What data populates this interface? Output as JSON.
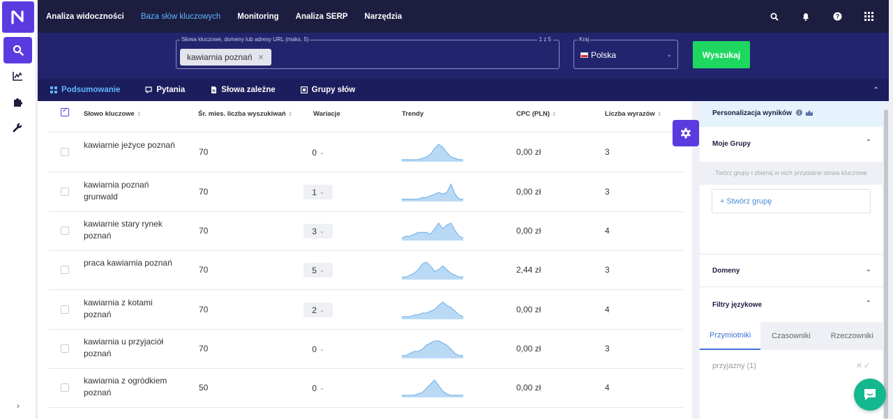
{
  "app": {
    "logo_letter": "N",
    "accent": "#5b3be0"
  },
  "topnav": [
    {
      "label": "Analiza widoczności",
      "active": false
    },
    {
      "label": "Baza słów kluczowych",
      "active": true
    },
    {
      "label": "Monitoring",
      "active": false
    },
    {
      "label": "Analiza SERP",
      "active": false
    },
    {
      "label": "Narzędzia",
      "active": false
    }
  ],
  "top_icons": [
    "search-icon",
    "bell-icon",
    "help-icon",
    "apps-grid-icon"
  ],
  "sidebar": {
    "items": [
      {
        "icon": "search-icon",
        "active": true
      },
      {
        "icon": "chart-icon",
        "active": false
      },
      {
        "icon": "puzzle-icon",
        "active": false
      },
      {
        "icon": "wrench-icon",
        "active": false
      }
    ],
    "expand_label": "›"
  },
  "search": {
    "keywords_label": "Słowa kluczowe, domeny lub adresy URL (maks. 5)",
    "counter": "1 z 5",
    "chip": "kawiarnia poznań",
    "country_label": "Kraj",
    "country_value": "Polska",
    "submit_label": "Wyszukaj"
  },
  "tabs": [
    {
      "label": "Podsumowanie",
      "icon": "grid-icon",
      "active": true
    },
    {
      "label": "Pytania",
      "icon": "question-bubble-icon",
      "active": false
    },
    {
      "label": "Słowa zależne",
      "icon": "document-icon",
      "active": false
    },
    {
      "label": "Grupy słów",
      "icon": "group-icon",
      "active": false
    }
  ],
  "table": {
    "columns": {
      "keyword": "Słowo kluczowe",
      "volume": "Śr. mies. liczba wyszukiwań",
      "variations": "Wariacje",
      "trends": "Trendy",
      "cpc": "CPC (PLN)",
      "words": "Liczba wyrazów"
    },
    "rows": [
      {
        "keyword": "kawiarnie jeżyce poznań",
        "volume": "70",
        "variations": "0",
        "cpc": "0,00 zł",
        "words": "3",
        "trend": [
          1,
          1,
          1,
          1,
          1,
          2,
          3,
          5,
          9,
          12,
          10,
          6,
          3,
          2,
          1,
          1
        ]
      },
      {
        "keyword": "kawiarnia poznań grunwald",
        "volume": "70",
        "variations": "1",
        "cpc": "0,00 zł",
        "words": "3",
        "trend": [
          1,
          1,
          1,
          1,
          1,
          2,
          2,
          3,
          4,
          5,
          4,
          5,
          10,
          4,
          1,
          1
        ]
      },
      {
        "keyword": "kawiarnie stary rynek poznań",
        "volume": "70",
        "variations": "3",
        "cpc": "0,00 zł",
        "words": "4",
        "trend": [
          1,
          2,
          2,
          3,
          4,
          4,
          4,
          3,
          6,
          9,
          6,
          8,
          9,
          5,
          2,
          1
        ]
      },
      {
        "keyword": "praca kawiarnia poznań",
        "volume": "70",
        "variations": "5",
        "cpc": "2,44 zł",
        "words": "3",
        "trend": [
          1,
          1,
          2,
          3,
          5,
          8,
          9,
          7,
          4,
          5,
          7,
          5,
          3,
          2,
          1,
          1
        ]
      },
      {
        "keyword": "kawiarnia z kotami poznań",
        "volume": "70",
        "variations": "2",
        "cpc": "0,00 zł",
        "words": "4",
        "trend": [
          1,
          1,
          1,
          2,
          2,
          3,
          3,
          4,
          5,
          7,
          9,
          7,
          6,
          4,
          2,
          1
        ]
      },
      {
        "keyword": "kawiarnia u przyjaciół poznań",
        "volume": "70",
        "variations": "0",
        "cpc": "0,00 zł",
        "words": "3",
        "trend": [
          1,
          1,
          2,
          3,
          3,
          4,
          6,
          7,
          8,
          8,
          7,
          6,
          4,
          2,
          1,
          1
        ]
      },
      {
        "keyword": "kawiarnia z ogródkiem poznań",
        "volume": "50",
        "variations": "0",
        "cpc": "0,00 zł",
        "words": "4",
        "trend": [
          1,
          1,
          1,
          1,
          2,
          3,
          6,
          9,
          12,
          8,
          4,
          2,
          1,
          1,
          1,
          1
        ]
      }
    ]
  },
  "right_panel": {
    "title": "Personalizacja wyników",
    "groups_title": "Moje Grupy",
    "groups_hint": "Twórz grupy i zbieraj w nich przydatne słowa kluczowe",
    "create_group": "+ Stwórz grupę",
    "domains_title": "Domeny",
    "lang_title": "Filtry językowe",
    "lang_tabs": [
      "Przymiotniki",
      "Czasowniki",
      "Rzeczowniki"
    ],
    "lang_item": "przyjazny (1)",
    "lang_actions": "✕✓"
  }
}
